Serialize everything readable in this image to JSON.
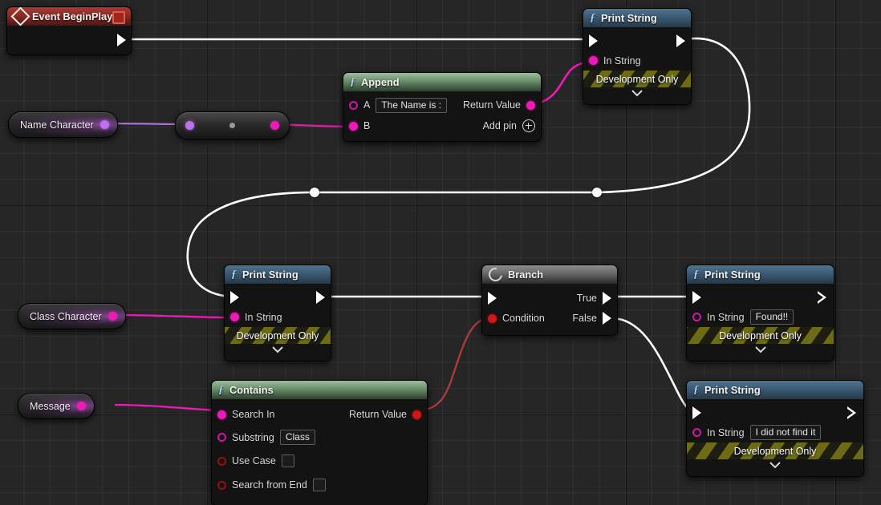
{
  "graph": {
    "title": "Blueprint Event Graph",
    "background_color": "#262626",
    "grid_line_color": "#3a3a3a",
    "exec_wire_color": "#ffffff",
    "string_wire_color": "#ef19b8",
    "name_wire_color": "#bf6ff0",
    "bool_wire_color": "#b23a3a"
  },
  "nodes": {
    "event_begin_play": {
      "title": "Event BeginPlay",
      "icon": "event-diamond-icon",
      "stop_icon": "stop-square-icon"
    },
    "name_character_var": {
      "label": "Name Character",
      "pin": "name-output-pin"
    },
    "convert_node": {
      "label": "",
      "in_pin": "name-input-pin",
      "out_pin": "string-output-pin"
    },
    "append": {
      "title": "Append",
      "icon": "function-f-icon",
      "pin_a_label": "A",
      "pin_a_value": "The Name is :",
      "pin_b_label": "B",
      "return_label": "Return Value",
      "add_pin_label": "Add pin",
      "add_pin_icon": "plus-circle-icon"
    },
    "print_string_top": {
      "title": "Print String",
      "icon": "function-f-icon",
      "in_string_label": "In String",
      "dev_only_label": "Development Only",
      "expand_icon": "chevron-down-icon"
    },
    "print_string_middle": {
      "title": "Print String",
      "icon": "function-f-icon",
      "in_string_label": "In String",
      "dev_only_label": "Development Only",
      "expand_icon": "chevron-down-icon"
    },
    "class_character_var": {
      "label": "Class Character",
      "pin": "string-output-pin"
    },
    "branch": {
      "title": "Branch",
      "icon": "branch-flow-icon",
      "condition_label": "Condition",
      "true_label": "True",
      "false_label": "False"
    },
    "print_string_found": {
      "title": "Print String",
      "icon": "function-f-icon",
      "in_string_label": "In String",
      "in_string_value": "Found!!",
      "dev_only_label": "Development Only",
      "expand_icon": "chevron-down-icon"
    },
    "print_string_not_found": {
      "title": "Print String",
      "icon": "function-f-icon",
      "in_string_label": "In String",
      "in_string_value": "I did not find it",
      "dev_only_label": "Development Only",
      "expand_icon": "chevron-down-icon"
    },
    "message_var": {
      "label": "Message",
      "pin": "string-output-pin"
    },
    "contains": {
      "title": "Contains",
      "icon": "function-f-icon",
      "search_in_label": "Search In",
      "substring_label": "Substring",
      "substring_value": "Class",
      "use_case_label": "Use Case",
      "use_case_checked": false,
      "search_from_end_label": "Search from End",
      "search_from_end_checked": false,
      "return_label": "Return Value"
    }
  }
}
